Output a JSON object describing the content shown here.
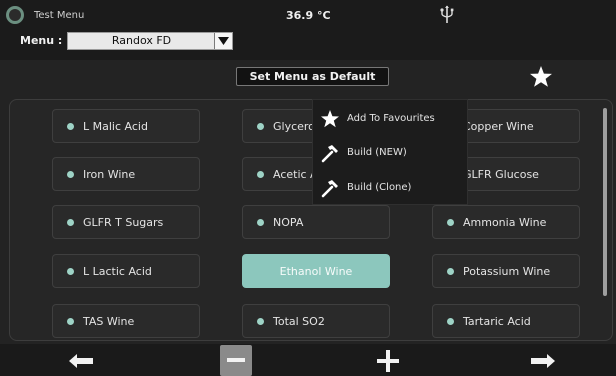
{
  "header": {
    "title": "Test Menu",
    "temperature": "36.9 °C",
    "menu_label": "Menu :",
    "menu_value": "Randox FD",
    "set_default_label": "Set Menu as Default"
  },
  "tests": [
    {
      "label": "L Malic Acid"
    },
    {
      "label": "Glycerol"
    },
    {
      "label": "Copper Wine"
    },
    {
      "label": "Iron Wine"
    },
    {
      "label": "Acetic Acid"
    },
    {
      "label": "GLFR Glucose"
    },
    {
      "label": "GLFR T Sugars"
    },
    {
      "label": "NOPA"
    },
    {
      "label": "Ammonia Wine"
    },
    {
      "label": "L Lactic Acid"
    },
    {
      "label": "Ethanol Wine"
    },
    {
      "label": "Potassium Wine"
    },
    {
      "label": "TAS Wine"
    },
    {
      "label": "Total SO2"
    },
    {
      "label": "Tartaric Acid"
    }
  ],
  "context_menu": {
    "items": [
      {
        "label": "Add To Favourites",
        "icon": "star-icon"
      },
      {
        "label": "Build (NEW)",
        "icon": "hammer-icon"
      },
      {
        "label": "Build (Clone)",
        "icon": "hammer-icon"
      }
    ]
  },
  "selected_test": "Ethanol Wine",
  "colors": {
    "accent": "#8cc7bd",
    "dot": "#9ed3c6",
    "background": "#232323"
  }
}
